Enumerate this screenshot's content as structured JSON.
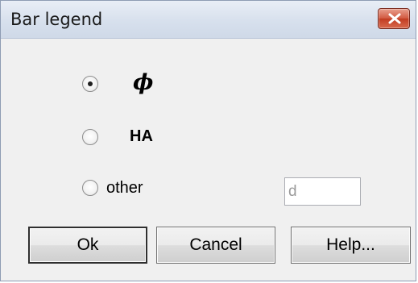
{
  "window": {
    "title": "Bar legend",
    "close_icon": "close-icon"
  },
  "options": {
    "selected": "phi",
    "phi_label": "ϕ",
    "ha_label": "HA",
    "other_label": "other"
  },
  "other_input": {
    "value": "d"
  },
  "buttons": {
    "ok_label": "Ok",
    "cancel_label": "Cancel",
    "help_label": "Help..."
  },
  "colors": {
    "close_button": "#c23c22",
    "dialog_background": "#f0f0f0"
  }
}
